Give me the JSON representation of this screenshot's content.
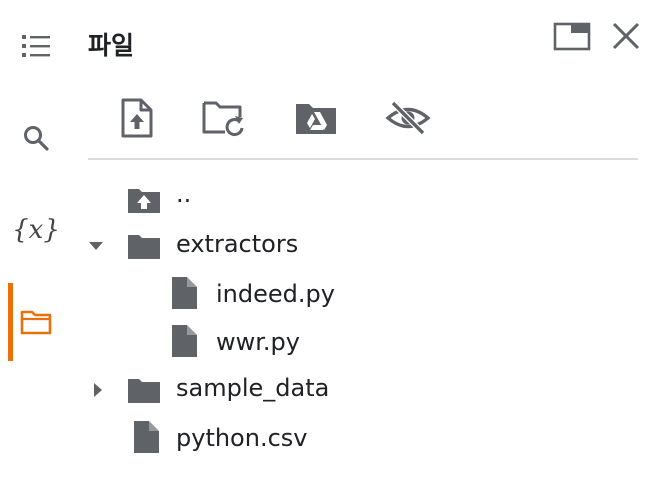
{
  "panel": {
    "title": "파일"
  },
  "rail": {
    "items": [
      {
        "icon": "toc-icon"
      },
      {
        "icon": "search-icon"
      },
      {
        "icon": "variables-icon",
        "glyph": "{x}"
      },
      {
        "icon": "folder-icon",
        "active": true
      }
    ],
    "accent_color": "#e8710a"
  },
  "header": {
    "buttons": [
      {
        "icon": "open-in-tab-icon"
      },
      {
        "icon": "close-icon"
      }
    ]
  },
  "toolbar": {
    "buttons": [
      {
        "icon": "upload-file-icon"
      },
      {
        "icon": "refresh-folder-icon"
      },
      {
        "icon": "mount-drive-icon"
      },
      {
        "icon": "hide-hidden-files-icon"
      }
    ]
  },
  "tree": {
    "parent": {
      "label": ".."
    },
    "items": [
      {
        "type": "folder",
        "label": "extractors",
        "expanded": true
      },
      {
        "type": "file",
        "label": "indeed.py",
        "indent": 1
      },
      {
        "type": "file",
        "label": "wwr.py",
        "indent": 1
      },
      {
        "type": "folder",
        "label": "sample_data",
        "expanded": false
      },
      {
        "type": "file",
        "label": "python.csv"
      }
    ]
  },
  "colors": {
    "icon": "#5f6368",
    "text": "#202124",
    "divider": "#dadce0"
  }
}
